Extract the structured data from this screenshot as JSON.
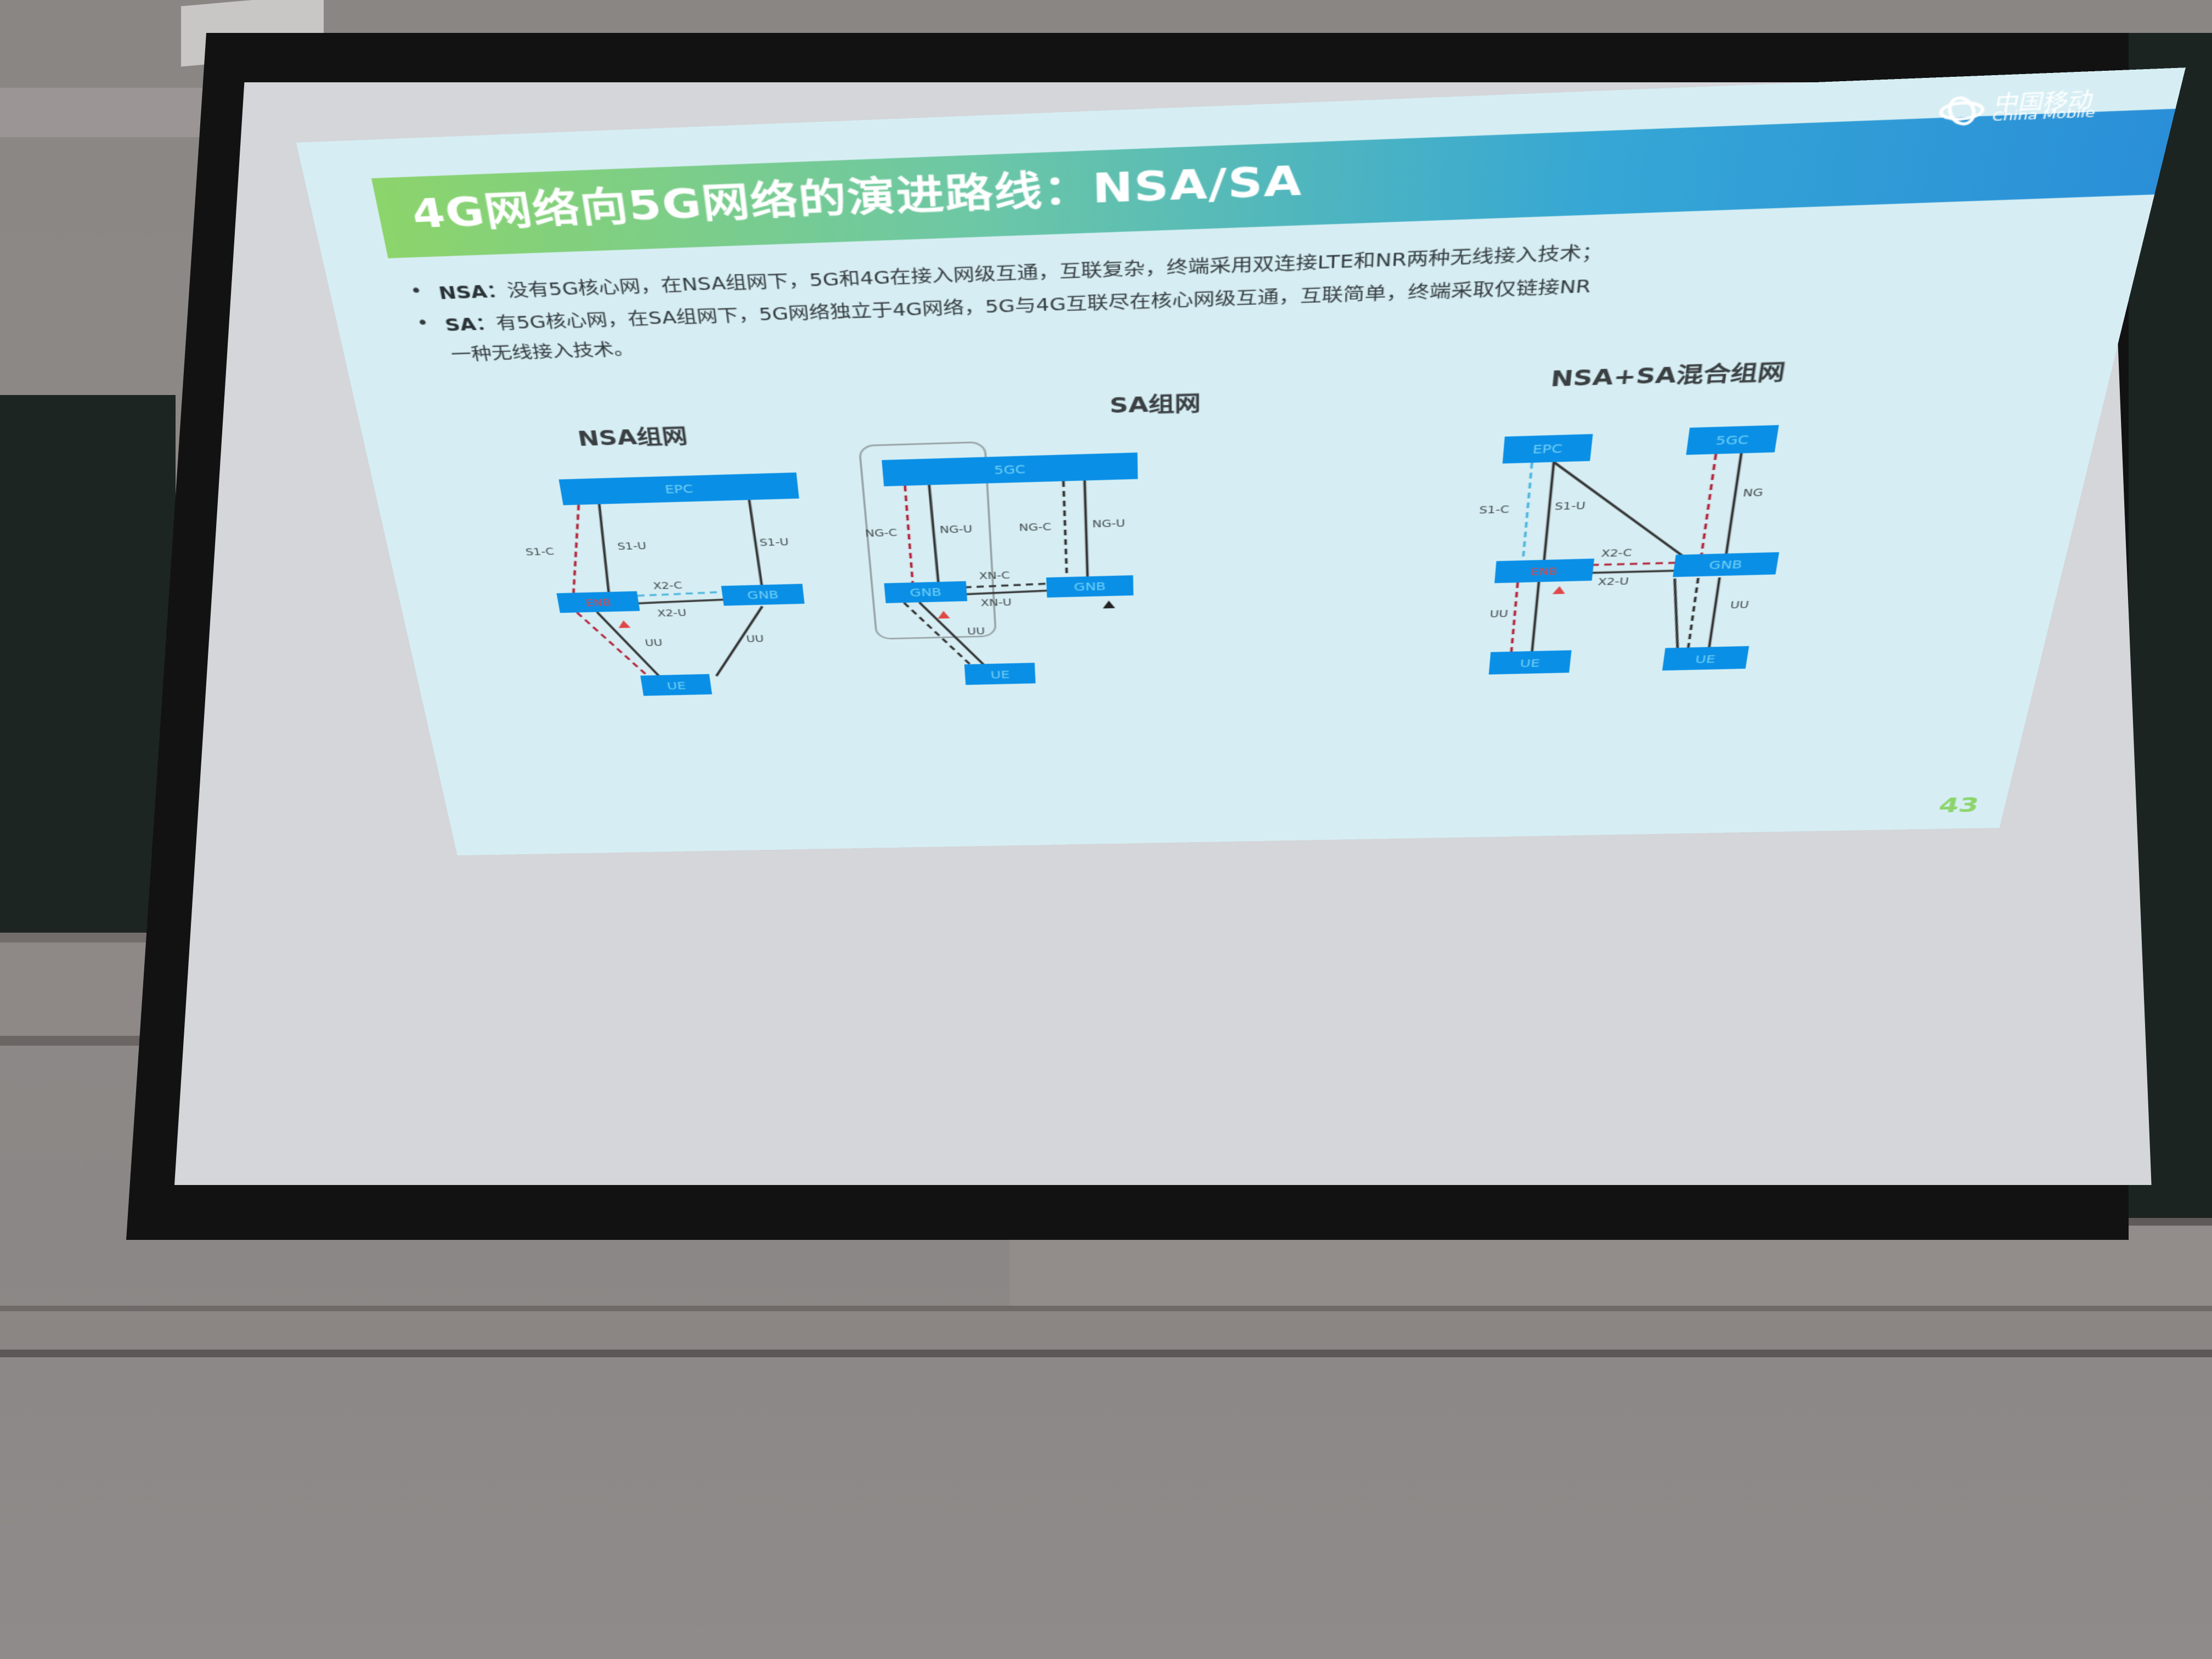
{
  "slide": {
    "title": "4G网络向5G网络的演进路线：NSA/SA",
    "logo": {
      "cn": "中国移动",
      "en": "China Mobile"
    },
    "bullets": [
      {
        "term": "NSA",
        "sep": "：",
        "text": "没有5G核心网，在NSA组网下，5G和4G在接入网级互通，互联复杂，终端采用双连接LTE和NR两种无线接入技术；"
      },
      {
        "term": "SA",
        "sep": "：",
        "text": "有5G核心网，在SA组网下，5G网络独立于4G网络，5G与4G互联尽在核心网级互通，互联简单，终端采取仅链接NR",
        "continuation": "一种无线接入技术。"
      }
    ],
    "page_number": "43",
    "colors": {
      "node_fill": "#0a8fe6",
      "node_text": "#6fd0f5",
      "title_gradient_start": "#8cd46b",
      "title_gradient_end": "#2a8fd8",
      "control_link": "#b3263c",
      "x2c_link": "#4fb6e0",
      "enb_text": "#e04646"
    }
  },
  "diagrams": {
    "nsa": {
      "title": "NSA组网",
      "nodes": {
        "core": "EPC",
        "lte": "ENB",
        "nr": "GNB",
        "ue": "UE"
      },
      "links": {
        "s1c": "S1-C",
        "s1u_left": "S1-U",
        "s1u_right": "S1-U",
        "x2c": "X2-C",
        "x2u": "X2-U",
        "uu_left": "UU",
        "uu_right": "UU"
      }
    },
    "sa": {
      "title": "SA组网",
      "nodes": {
        "core": "5GC",
        "gnb_left": "GNB",
        "gnb_right": "GNB",
        "ue": "UE"
      },
      "links": {
        "ngc_left": "NG-C",
        "ngu_left": "NG-U",
        "ngc_right": "NG-C",
        "ngu_right": "NG-U",
        "xnc": "XN-C",
        "xnu": "XN-U",
        "uu": "UU"
      }
    },
    "mixed": {
      "title": "NSA+SA混合组网",
      "nodes": {
        "epc": "EPC",
        "fivegc": "5GC",
        "enb": "ENB",
        "gnb": "GNB",
        "ue_left": "UE",
        "ue_right": "UE"
      },
      "links": {
        "s1c": "S1-C",
        "s1u": "S1-U",
        "ng": "NG",
        "x2c": "X2-C",
        "x2u": "X2-U",
        "uu_left": "UU",
        "uu_right": "UU"
      }
    }
  }
}
